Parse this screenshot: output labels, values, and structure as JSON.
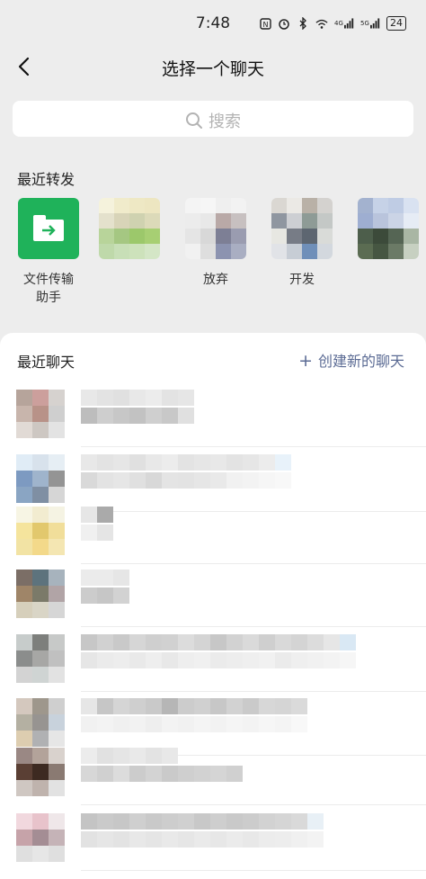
{
  "status": {
    "time": "7:48",
    "battery": "24",
    "net1": "4G",
    "net2": "5G"
  },
  "nav": {
    "title": "选择一个聊天"
  },
  "search": {
    "placeholder": "搜索"
  },
  "recent_forward": {
    "title": "最近转发",
    "items": [
      {
        "label": "文件传输\n助手",
        "type": "file-transfer",
        "colors": []
      },
      {
        "label": "",
        "type": "avatar",
        "colors": [
          "#f5f2dc",
          "#f0ebcb",
          "#eee8c4",
          "#ede6c1",
          "#e4e1cc",
          "#d8d4b8",
          "#cfd2b0",
          "#dcdab9",
          "#b8d49a",
          "#a5c782",
          "#9cc86b",
          "#a7cf73",
          "#bfd9aa",
          "#c8dfb7",
          "#cde2bb",
          "#d4e6c6"
        ]
      },
      {
        "label": "放弃",
        "type": "avatar",
        "colors": [
          "#f4f4f4",
          "#f6f6f6",
          "#efefef",
          "#f2f2f2",
          "#ececec",
          "#e8e8e8",
          "#b9a9a7",
          "#c7c0c0",
          "#e5e5e5",
          "#d8d8d8",
          "#7d7f95",
          "#9a9cb0",
          "#f1f1f1",
          "#dedede",
          "#8c93b0",
          "#a9aec2"
        ]
      },
      {
        "label": "开发",
        "type": "avatar",
        "colors": [
          "#dad7d2",
          "#ebe9e5",
          "#b9b1a7",
          "#d4d2cf",
          "#8f96a0",
          "#cdcfd3",
          "#8e9b96",
          "#c4c8c6",
          "#e7e7e2",
          "#777c86",
          "#5d6671",
          "#d9dbd8",
          "#e1e3e7",
          "#c7cdd5",
          "#6f8fb9",
          "#d3d8de"
        ]
      },
      {
        "label": "",
        "type": "avatar",
        "colors": [
          "#a3b2cf",
          "#c6d2e7",
          "#bfcce4",
          "#d9e2f1",
          "#9eaed1",
          "#b9c4dc",
          "#cbd4e6",
          "#e6ecf5",
          "#4d5e4b",
          "#3c4a3a",
          "#556554",
          "#a9b6a4",
          "#5b6c52",
          "#465642",
          "#6b7a66",
          "#c7d0c1"
        ]
      }
    ]
  },
  "recent_chats": {
    "title": "最近聊天",
    "create_label": "创建新的聊天",
    "rows": [
      {
        "avatar": [
          "#b6a49b",
          "#cc9f9c",
          "#d6d2cf",
          "#c8b5ac",
          "#b89288",
          "#cfcfcf",
          "#e1dad5",
          "#cdc7c2",
          "#e3e3e3"
        ],
        "name": [
          "#e8e8e8",
          "#e3e3e3",
          "#e0e0e0",
          "#e8e8e8",
          "#ececec",
          "#e3e3e3",
          "#e6e6e6"
        ],
        "msg": [
          "#bdbdbd",
          "#cecece",
          "#c7c7c7",
          "#c2c2c2",
          "#cfcfcf",
          "#c8c8c8",
          "#e0e0e0"
        ]
      },
      {
        "avatar": [
          "#e0ecf6",
          "#d8e2ec",
          "#e6eef4",
          "#7d9ac1",
          "#9fb4cc",
          "#949494",
          "#8aa5c3",
          "#7f8fa3",
          "#d6d6d6"
        ],
        "name": [
          "#e8e8e8",
          "#e3e3e3",
          "#e6e6e6",
          "#e0e0e0",
          "#e8e8e8",
          "#ececec",
          "#e3e3e3",
          "#e6e6e6",
          "#e8e8e8",
          "#e3e3e3",
          "#e6e6e6",
          "#ececec",
          "#e8f2fa"
        ],
        "msg": [
          "#d9d9d9",
          "#e3e3e3",
          "#e6e6e6",
          "#e0e0e0",
          "#d8d8d8",
          "#e4e4e4",
          "#e3e3e3",
          "#e6e6e6",
          "#e9e9e9",
          "#f1f1f1",
          "#f3f3f3",
          "#f6f6f6",
          "#f8f8f8"
        ]
      },
      {
        "avatar": [
          "#f7f5e4",
          "#f2ecd0",
          "#f5f3e3",
          "#f5e49d",
          "#e2c86d",
          "#f1de9a",
          "#f2e3a4",
          "#f3d98a",
          "#f4e6b2"
        ],
        "name": [
          "#e6e6e6",
          "#aaaaaa"
        ],
        "msg": [
          "#f0f0f0",
          "#e5e5e5"
        ]
      },
      {
        "avatar": [
          "#7b6e66",
          "#5d737d",
          "#a7b3bd",
          "#9f8568",
          "#7b7a69",
          "#b1a4a6",
          "#d6cfbb",
          "#d9d5c6",
          "#d6d6d6"
        ],
        "name": [
          "#ebebeb",
          "#ebebeb",
          "#e6e6e6"
        ],
        "msg": [
          "#cccccc",
          "#c6c6c6",
          "#d2d2d2"
        ]
      },
      {
        "avatar": [
          "#c7cccb",
          "#7d7f7c",
          "#c7c9c8",
          "#8b8d8c",
          "#a7a7a5",
          "#c0c0c0",
          "#d3d3d3",
          "#cfd4d3",
          "#e2e2e2"
        ],
        "name": [
          "#c7c7c7",
          "#d1d1d1",
          "#c9c9c9",
          "#d6d6d6",
          "#cfcfcf",
          "#d1d1d1",
          "#dcdcdc",
          "#d4d4d4",
          "#c7c7c7",
          "#d2d2d2",
          "#dadada",
          "#cfcfcf",
          "#d9d9d9",
          "#d4d4d4",
          "#dcdcdc",
          "#e6e6e6",
          "#d9e8f4"
        ],
        "msg": [
          "#e6e6e6",
          "#ebebeb",
          "#ededed",
          "#e9e9e9",
          "#eeeeee",
          "#e8e8e8",
          "#eeeeee",
          "#f0f0f0",
          "#ebebeb",
          "#ededed",
          "#efefef",
          "#f1f1f1",
          "#ebebeb",
          "#efefef",
          "#f1f1f1",
          "#f3f3f3",
          "#f6f6f6"
        ]
      },
      {
        "avatar": [
          "#d4c8be",
          "#9e978c",
          "#cfcfcf",
          "#b4b0a2",
          "#979491",
          "#c8d2dc",
          "#ddcdb0",
          "#b0b1b3",
          "#e6e6e6"
        ],
        "name": [
          "#e6e6e6",
          "#c6c6c6",
          "#d5d5d5",
          "#cfcfcf",
          "#c9c9c9",
          "#b6b6b6",
          "#cccccc",
          "#d0d0d0",
          "#c7c7c7",
          "#d2d2d2",
          "#cacaca",
          "#d7d7d7",
          "#d5d5d5",
          "#dadada"
        ],
        "msg": [
          "#f1f1f1",
          "#f3f3f3",
          "#f0f0f0",
          "#f2f2f2",
          "#eeeeee",
          "#f3f3f3",
          "#f1f1f1",
          "#f4f4f4",
          "#f2f2f2",
          "#f5f5f5",
          "#f3f3f3",
          "#f6f6f6",
          "#f4f4f4",
          "#f8f8f8"
        ]
      },
      {
        "avatar": [
          "#9a8884",
          "#b3a39a",
          "#d9d2cd",
          "#5a3f34",
          "#3d2a21",
          "#8a7a72",
          "#cfc7c2",
          "#bfb3ad",
          "#e2e2e2"
        ],
        "name": [
          "#ececec",
          "#e1e1e1",
          "#e5e5e5",
          "#e9e9e9",
          "#e3e3e3",
          "#e8e8e8"
        ],
        "msg": [
          "#d7d7d7",
          "#d0d0d0",
          "#dcdcdc",
          "#cccccc",
          "#d3d3d3",
          "#cacaca",
          "#cfcfcf",
          "#d2d2d2",
          "#d5d5d5",
          "#d0d0d0"
        ]
      },
      {
        "avatar": [
          "#f1d8de",
          "#e8c3cb",
          "#efe7e9",
          "#c6a3a9",
          "#a48d94",
          "#c5b3b7",
          "#dfdfdf",
          "#e6e6e6",
          "#dfdfdf"
        ],
        "name": [
          "#c4c4c4",
          "#cacaca",
          "#c7c7c7",
          "#cfcfcf",
          "#c9c9c9",
          "#cdcdcd",
          "#d0d0d0",
          "#c8c8c8",
          "#cecece",
          "#c9c9c9",
          "#cccccc",
          "#d2d2d2",
          "#d5d5d5",
          "#d9d9d9",
          "#e8f0f6"
        ],
        "msg": [
          "#e2e2e2",
          "#e6e6e6",
          "#e3e3e3",
          "#e8e8e8",
          "#e5e5e5",
          "#e9e9e9",
          "#e6e6e6",
          "#eaeaea",
          "#e7e7e7",
          "#ebebeb",
          "#e8e8e8",
          "#ececec",
          "#ededed",
          "#f0f0f0",
          "#f3f3f3"
        ]
      }
    ]
  }
}
